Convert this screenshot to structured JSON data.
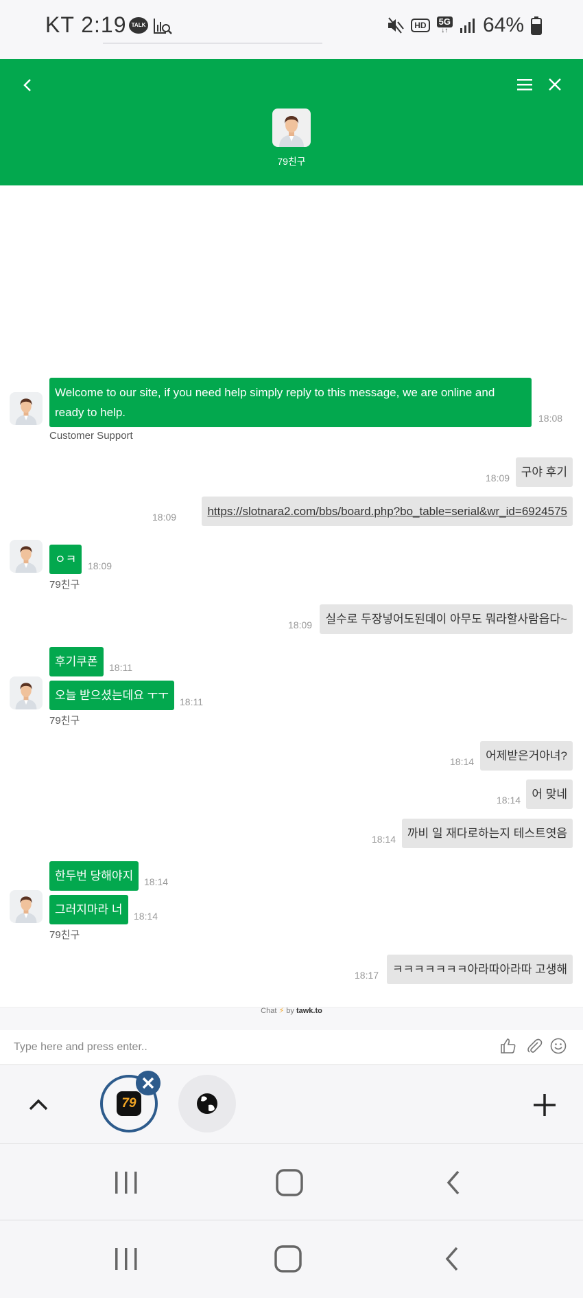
{
  "status_bar": {
    "carrier_time": "KT  2:19",
    "talk_badge": "TALK",
    "network_hd": "HD",
    "network_5g": "5G",
    "battery": "64%"
  },
  "header": {
    "agent_name": "79친구",
    "brand_color": "#03a84e"
  },
  "messages": {
    "m1": {
      "text": "Welcome to our site, if you need help simply reply to this message, we are online and ready to help.",
      "time": "18:08",
      "sender": "Customer Support"
    },
    "m2": {
      "text": "구야 후기",
      "time": "18:09"
    },
    "m3": {
      "text": "https://slotnara2.com/bbs/board.php?bo_table=serial&wr_id=6924575",
      "time": "18:09"
    },
    "m4": {
      "text": "ㅇㅋ",
      "time": "18:09",
      "sender": "79친구"
    },
    "m5": {
      "text": "실수로 두장넣어도된데이 아무도 뭐라할사람읍다~",
      "time": "18:09"
    },
    "m6": {
      "text": "후기쿠폰",
      "time": "18:11"
    },
    "m7": {
      "text": "오늘 받으셨는데요 ㅜㅜ",
      "time": "18:11",
      "sender": "79친구"
    },
    "m8": {
      "text": "어제받은거아녀?",
      "time": "18:14"
    },
    "m9": {
      "text": "어 맞네",
      "time": "18:14"
    },
    "m10": {
      "text": "까비 일 재다로하는지 테스트엿음",
      "time": "18:14"
    },
    "m11": {
      "text": "한두번 당해야지",
      "time": "18:14"
    },
    "m12": {
      "text": "그러지마라 너",
      "time": "18:14",
      "sender": "79친구"
    },
    "m13": {
      "text": "ㅋㅋㅋㅋㅋㅋㅋ아라따아라따 고생해",
      "time": "18:17"
    }
  },
  "footer": {
    "powered_prefix": "Chat",
    "powered_by": "by",
    "powered_brand": "tawk.to",
    "input_placeholder": "Type here and press enter.."
  },
  "app_bar": {
    "tab1_logo": "79"
  },
  "icons": {
    "back": "chevron-left-icon",
    "menu": "hamburger-menu-icon",
    "close": "close-icon",
    "like": "thumbs-up-icon",
    "attach": "paperclip-icon",
    "emoji": "smiley-icon"
  }
}
